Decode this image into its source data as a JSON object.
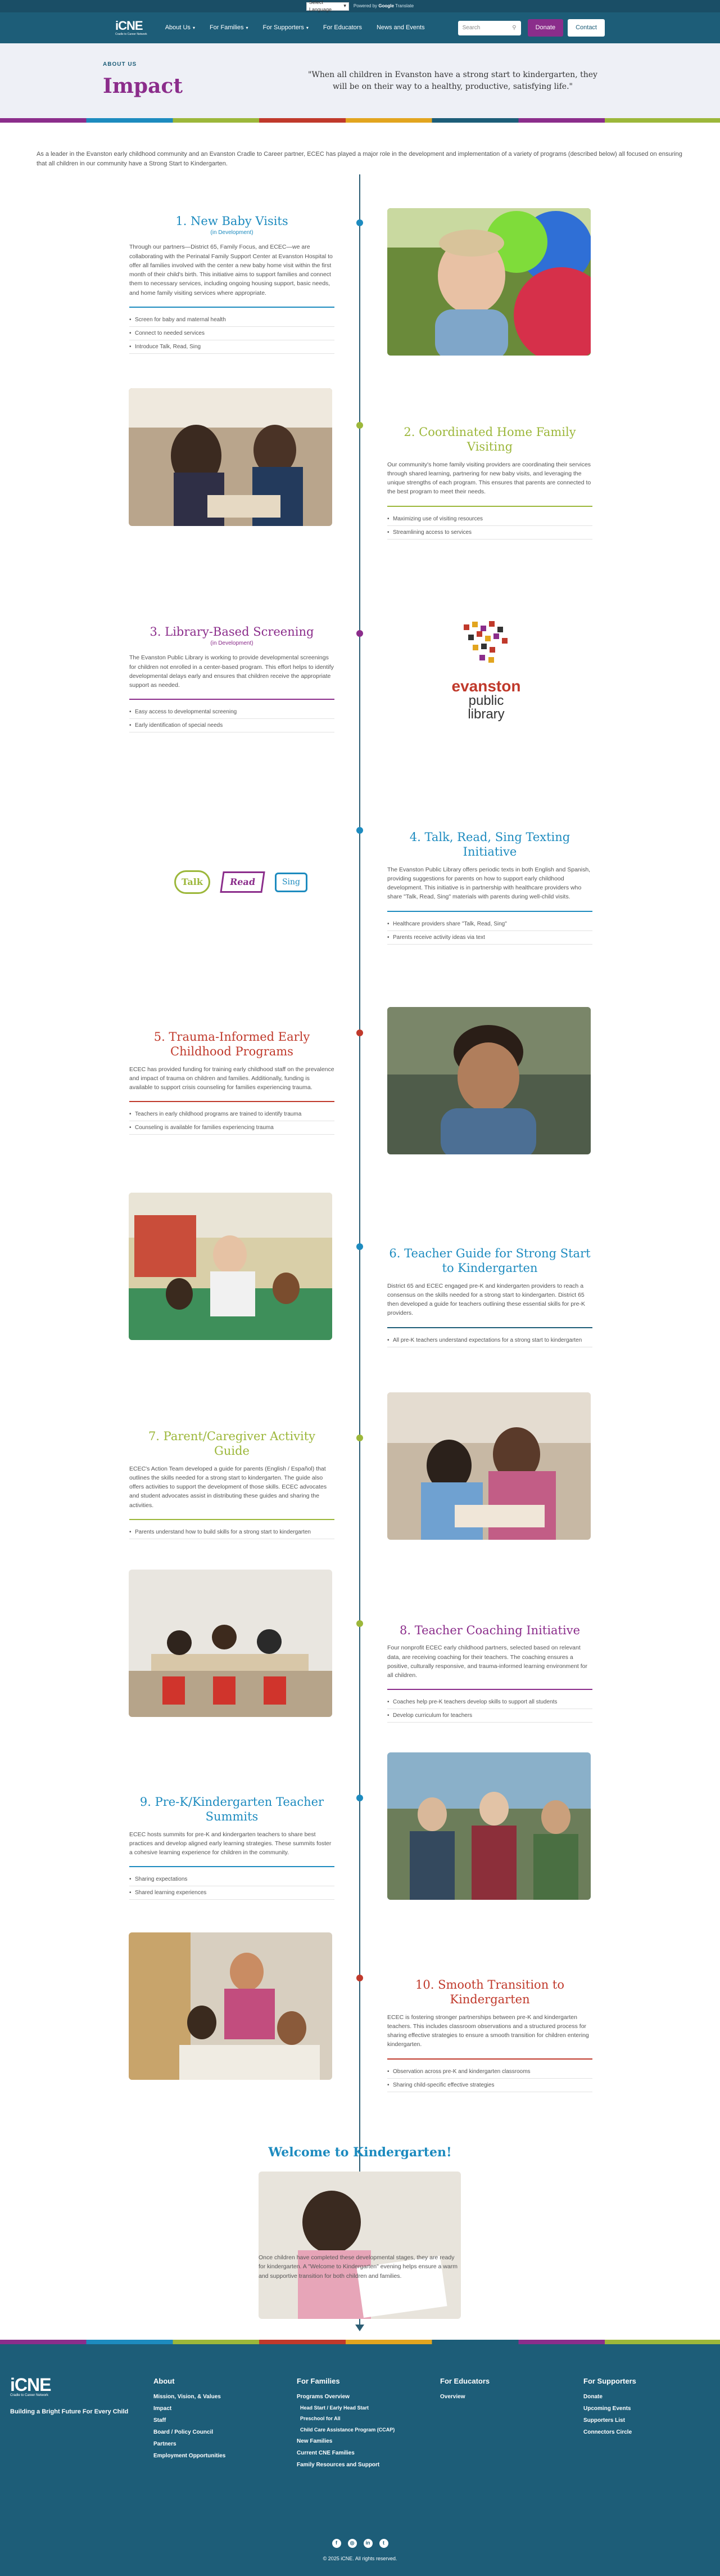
{
  "topbar": {
    "language": "Select Language",
    "powered_prefix": "Powered by",
    "powered_brand": "Google",
    "powered_suffix": "Translate"
  },
  "header": {
    "logo": "iCNE",
    "logo_tag": "Cradle to Career Network",
    "nav": [
      "About Us",
      "For Families",
      "For Supporters",
      "For Educators",
      "News and Events"
    ],
    "search_placeholder": "Search",
    "donate": "Donate",
    "contact": "Contact"
  },
  "hero": {
    "eyebrow": "ABOUT US",
    "title": "Impact",
    "quote": "\"When all children in Evanston have a strong start to kindergarten, they will be on their way to a healthy, productive, satisfying life.\""
  },
  "intro": "As a leader in the Evanston early childhood community and an Evanston Cradle to Career partner, ECEC has played a major role in the development and implementation of a variety of programs (described below) all focused on ensuring that all children in our community have a Strong Start to Kindergarten.",
  "colors": {
    "blue": "#1d8bbf",
    "green": "#9cb73a",
    "purple": "#8b2d8b",
    "red": "#c0392b",
    "navy": "#1d5d78"
  },
  "steps": [
    {
      "title": "1. New Baby Visits",
      "sub": "(in Development)",
      "body": "Through our partners—District 65, Family Focus, and ECEC—we are collaborating with the Perinatal Family Support Center at Evanston Hospital to offer all families involved with the center a new baby home visit within the first month of their child's birth. This initiative aims to support families and connect them to necessary services, including ongoing housing support, basic needs, and home family visiting services where appropriate.",
      "bullets": [
        "Screen for baby and maternal health",
        "Connect to needed services",
        "Introduce Talk, Read, Sing"
      ]
    },
    {
      "title": "2. Coordinated Home Family Visiting",
      "sub": "",
      "body": "Our community's home family visiting providers are coordinating their services through shared learning, partnering for new baby visits, and leveraging the unique strengths of each program. This ensures that parents are connected to the best program to meet their needs.",
      "bullets": [
        "Maximizing use of visiting resources",
        "Streamlining access to services"
      ]
    },
    {
      "title": "3. Library-Based Screening",
      "sub": "(in Development)",
      "body": "The Evanston Public Library is working to provide developmental screenings for children not enrolled in a center-based program. This effort helps to identify developmental delays early and ensures that children receive the appropriate support as needed.",
      "bullets": [
        "Easy access to developmental screening",
        "Early identification of special needs"
      ]
    },
    {
      "title": "4. Talk, Read, Sing Texting Initiative",
      "sub": "",
      "body": "The Evanston Public Library offers periodic texts in both English and Spanish, providing suggestions for parents on how to support early childhood development. This initiative is in partnership with healthcare providers who share \"Talk, Read, Sing\" materials with parents during well-child visits.",
      "bullets": [
        "Healthcare providers share \"Talk, Read, Sing\"",
        "Parents receive activity ideas via text"
      ]
    },
    {
      "title": "5. Trauma-Informed Early Childhood Programs",
      "sub": "",
      "body": "ECEC has provided funding for training early childhood staff on the prevalence and impact of trauma on children and families. Additionally, funding is available to support crisis counseling for families experiencing trauma.",
      "bullets": [
        "Teachers in early childhood programs are trained to identify trauma",
        "Counseling is available for families experiencing trauma"
      ]
    },
    {
      "title": "6. Teacher Guide for Strong Start to Kindergarten",
      "sub": "",
      "body": "District 65 and ECEC engaged pre-K and kindergarten providers to reach a consensus on the skills needed for a strong start to kindergarten. District 65 then developed a guide for teachers outlining these essential skills for pre-K providers.",
      "link": "guide for teachers",
      "bullets": [
        "All pre-K teachers understand expectations for a strong start to kindergarten"
      ]
    },
    {
      "title": "7. Parent/Caregiver Activity Guide",
      "sub": "",
      "body": "ECEC's Action Team developed a guide for parents (English / Español) that outlines the skills needed for a strong start to kindergarten. The guide also offers activities to support the development of those skills. ECEC advocates and student advocates assist in distributing these guides and sharing the activities.",
      "bullets": [
        "Parents understand how to build skills for a strong start to kindergarten"
      ]
    },
    {
      "title": "8. Teacher Coaching Initiative",
      "sub": "",
      "body": "Four nonprofit ECEC early childhood partners, selected based on relevant data, are receiving coaching for their teachers. The coaching ensures a positive, culturally responsive, and trauma-informed learning environment for all children.",
      "bullets": [
        "Coaches help pre-K teachers develop skills to support all students",
        "Develop curriculum for teachers"
      ]
    },
    {
      "title": "9. Pre-K/Kindergarten Teacher Summits",
      "sub": "",
      "body": "ECEC hosts summits for pre-K and kindergarten teachers to share best practices and develop aligned early learning strategies. These summits foster a cohesive learning experience for children in the community.",
      "bullets": [
        "Sharing expectations",
        "Shared learning experiences"
      ]
    },
    {
      "title": "10. Smooth Transition to Kindergarten",
      "sub": "",
      "body": "ECEC is fostering stronger partnerships between pre-K and kindergarten teachers. This includes classroom observations and a structured process for sharing effective strategies to ensure a smooth transition for children entering kindergarten.",
      "bullets": [
        "Observation across pre-K and kindergarten classrooms",
        "Sharing child-specific effective strategies"
      ]
    }
  ],
  "library_logo": {
    "line1": "evanston",
    "line2": "public",
    "line3": "library"
  },
  "trs_labels": [
    "Talk",
    "Read",
    "Sing"
  ],
  "welcome": {
    "title": "Welcome to Kindergarten!",
    "body": "Once children have completed these developmental stages, they are ready for kindergarten. A \"Welcome to Kindergarten\" evening helps ensure a warm and supportive transition for both children and families."
  },
  "footer": {
    "logo": "iCNE",
    "logo_tag": "Cradle to Career Network",
    "tagline": "Building a Bright Future For Every Child",
    "columns": [
      {
        "title": "About",
        "links": [
          "Mission, Vision, & Values",
          "Impact",
          "Staff",
          "Board / Policy Council",
          "Partners",
          "Employment Opportunities"
        ]
      },
      {
        "title": "For Families",
        "links": [
          "Programs Overview",
          "Head Start / Early Head Start",
          "Preschool for All",
          "Child Care Assistance Program (CCAP)",
          "New Families",
          "Current CNE Families",
          "Family Resources and Support"
        ]
      },
      {
        "title": "For Educators",
        "links": [
          "Overview"
        ]
      },
      {
        "title": "For Supporters",
        "links": [
          "Donate",
          "Upcoming Events",
          "Supporters List",
          "Connectors Circle"
        ]
      }
    ],
    "social": [
      "f",
      "◎",
      "in",
      "t"
    ],
    "copyright": "© 2025 iCNE. All rights reserved."
  }
}
